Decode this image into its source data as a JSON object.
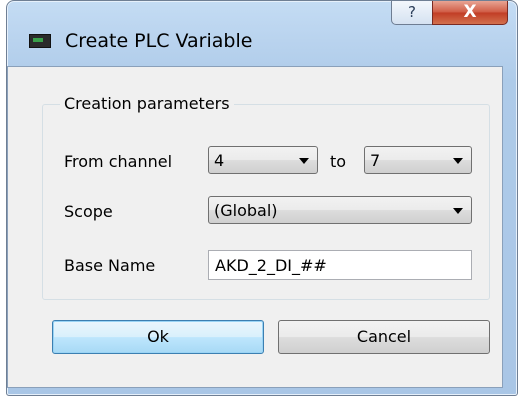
{
  "window": {
    "title": "Create PLC Variable",
    "help_label": "?",
    "close_label": "X"
  },
  "group": {
    "title": "Creation parameters"
  },
  "channel": {
    "from_label": "From channel",
    "from_value": "4",
    "to_label": "to",
    "to_value": "7"
  },
  "scope": {
    "label": "Scope",
    "value": "(Global)"
  },
  "base_name": {
    "label": "Base Name",
    "value": "AKD_2_DI_##"
  },
  "buttons": {
    "ok_label": "Ok",
    "cancel_label": "Cancel"
  },
  "icons": {
    "app": "app-icon",
    "help": "help-icon",
    "close": "close-icon",
    "dropdown": "chevron-down-icon"
  }
}
